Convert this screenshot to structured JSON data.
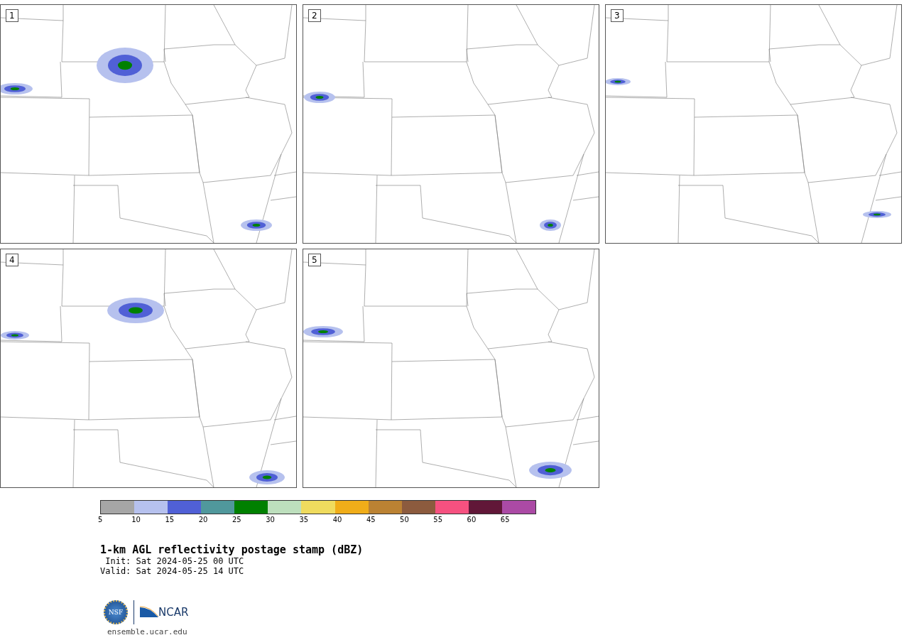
{
  "panels": [
    {
      "number": "1"
    },
    {
      "number": "2"
    },
    {
      "number": "3"
    },
    {
      "number": "4"
    },
    {
      "number": "5"
    }
  ],
  "colorbar": {
    "bins": [
      {
        "color": "#a6a6a6",
        "label": "5"
      },
      {
        "color": "#b6c1ee",
        "label": "10"
      },
      {
        "color": "#5060d6",
        "label": "15"
      },
      {
        "color": "#50989c",
        "label": "20"
      },
      {
        "color": "#008000",
        "label": "25"
      },
      {
        "color": "#bddfbd",
        "label": "30"
      },
      {
        "color": "#efdb5e",
        "label": "35"
      },
      {
        "color": "#f0ad19",
        "label": "40"
      },
      {
        "color": "#bb8233",
        "label": "45"
      },
      {
        "color": "#8c5b3e",
        "label": "50"
      },
      {
        "color": "#f65180",
        "label": "55"
      },
      {
        "color": "#611738",
        "label": "60"
      },
      {
        "color": "#ab4aa5",
        "label": "65"
      }
    ]
  },
  "title": "1-km AGL reflectivity postage stamp (dBZ)",
  "init": " Init: Sat 2024-05-25 00 UTC",
  "valid": "Valid: Sat 2024-05-25 14 UTC",
  "logos": {
    "nsf": "NSF",
    "ncar": "NCAR"
  },
  "site": "ensemble.ucar.edu"
}
